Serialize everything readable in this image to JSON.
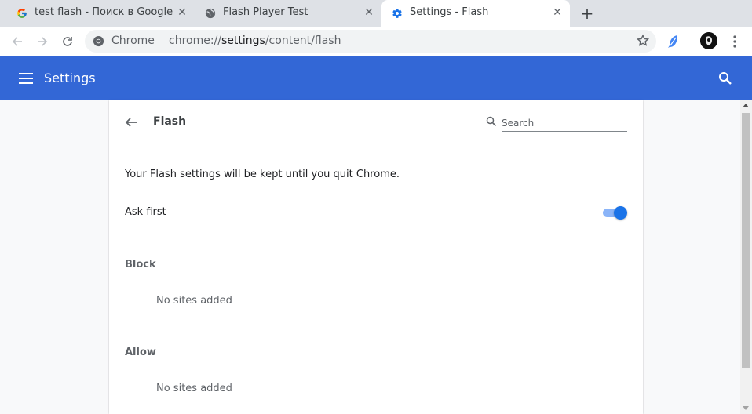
{
  "tabs": [
    {
      "title": "test flash - Поиск в Google",
      "icon": "google-icon",
      "active": false
    },
    {
      "title": "Flash Player Test",
      "icon": "globe-icon",
      "active": false
    },
    {
      "title": "Settings - Flash",
      "icon": "gear-icon",
      "active": true
    }
  ],
  "omnibox": {
    "chip": "Chrome",
    "url_scheme": "chrome://",
    "url_host": "settings",
    "url_path": "/content/flash"
  },
  "header": {
    "title": "Settings"
  },
  "page": {
    "title": "Flash",
    "search_placeholder": "Search",
    "note": "Your Flash settings will be kept until you quit Chrome.",
    "ask_first_label": "Ask first",
    "ask_first_enabled": true,
    "block_heading": "Block",
    "block_empty": "No sites added",
    "allow_heading": "Allow",
    "allow_empty": "No sites added"
  },
  "colors": {
    "header_bg": "#3367d6",
    "toggle_on": "#1a73e8",
    "tab_strip": "#dee1e6"
  }
}
